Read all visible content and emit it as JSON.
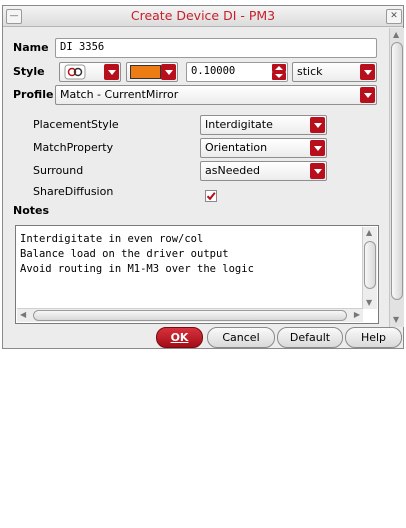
{
  "window": {
    "title": "Create  Device DI - PM3",
    "minimize_glyph": "—",
    "close_glyph": "✕"
  },
  "name": {
    "label": "Name",
    "value": "DI 3356"
  },
  "style": {
    "label": "Style",
    "swatch_color": "#ee7c14",
    "spin_value": "0.10000",
    "line_type": "stick"
  },
  "profile": {
    "label": "Profile",
    "value": "Match - CurrentMirror"
  },
  "params": [
    {
      "label": "PlacementStyle",
      "value": "Interdigitate"
    },
    {
      "label": "MatchProperty",
      "value": "Orientation"
    },
    {
      "label": "Surround",
      "value": "asNeeded"
    },
    {
      "label": "ShareDiffusion",
      "checked": true
    }
  ],
  "notes": {
    "label": "Notes",
    "lines": [
      "Interdigitate in even row/col",
      "Balance load on the driver output",
      "Avoid routing in M1-M3 over the logic"
    ]
  },
  "buttons": {
    "ok": "OK",
    "cancel": "Cancel",
    "default": "Default",
    "help": "Help"
  },
  "colors": {
    "accent": "#b70f1c",
    "title": "#c8202a",
    "swatch": "#ee7c14"
  }
}
